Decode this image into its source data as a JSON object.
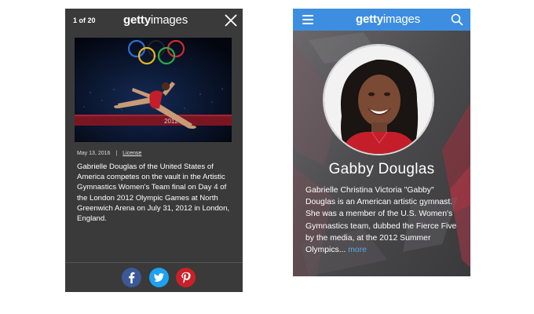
{
  "left_screen": {
    "counter": "1 of 20",
    "logo": {
      "bold": "getty",
      "regular": "images"
    },
    "photo_overlay_text": "2012",
    "meta": {
      "date": "May 13, 2016",
      "separator": "|",
      "license_label": "License"
    },
    "caption": "Gabrielle Douglas of the United States of America competes on the vault in the Artistic Gymnastics Women's Team final on Day 4 of the London 2012 Olympic Games at North Greenwich Arena on July 31, 2012 in London, England.",
    "share_icons": [
      "facebook-icon",
      "twitter-icon",
      "pinterest-icon"
    ]
  },
  "right_screen": {
    "logo": {
      "bold": "getty",
      "regular": "images"
    },
    "name": "Gabby Douglas",
    "bio": "Gabrielle Christina Victoria \"Gabby\" Douglas is an American artistic gymnast. She was a member of the U.S. Women's Gymnastics team, dubbed the Fierce Five by the media, at the 2012 Summer Olympics...",
    "more_label": "more"
  },
  "colors": {
    "left_background": "#3a3a3a",
    "right_header": "#3d8ee1",
    "more_link": "#5aa7ee",
    "facebook": "#3b5998",
    "twitter": "#1da1f2",
    "pinterest": "#cb2027",
    "leotard": "#c41e2a"
  }
}
